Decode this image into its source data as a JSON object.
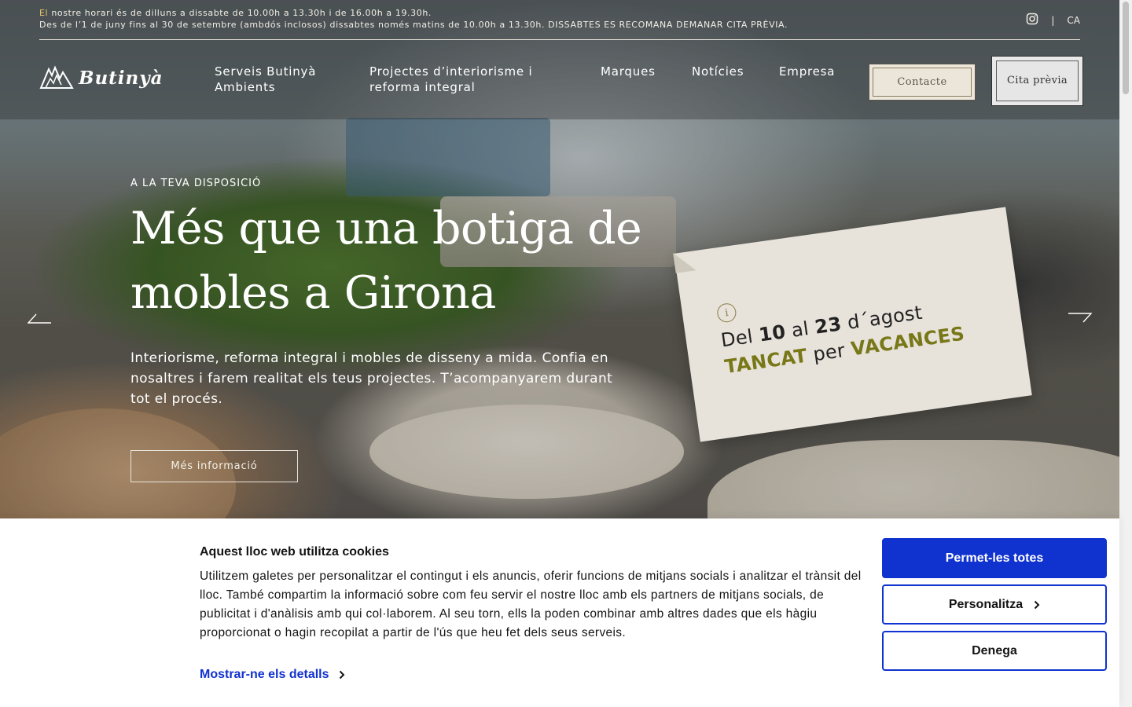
{
  "topbar": {
    "hours_accent": "El",
    "hours_line1": " nostre horari és de dilluns a dissabte de 10.00h a 13.30h i de 16.00h a 19.30h.",
    "hours_line2": "Des de l’1 de juny fins al 30 de setembre (ambdós inclosos) dissabtes només matins de 10.00h a 13.30h. DISSABTES ES RECOMANA DEMANAR CITA PRÈVIA.",
    "instagram_icon": "instagram-icon",
    "separator": "|",
    "language": "CA"
  },
  "logo": {
    "text": "Butinyà"
  },
  "nav": {
    "items": [
      {
        "label": "Serveis Butinyà Ambients"
      },
      {
        "label": "Projectes d’interiorisme i reforma integral"
      },
      {
        "label": "Marques"
      },
      {
        "label": "Notícies"
      },
      {
        "label": "Empresa"
      }
    ],
    "contact_label": "Contacte",
    "appointment_label": "Cita prèvia"
  },
  "hero": {
    "eyebrow": "A LA TEVA DISPOSICIÓ",
    "title": "Més que una botiga de mobles a Girona",
    "description": "Interiorisme, reforma integral i mobles de disseny a mida. Confia en nosaltres i farem realitat els teus projectes. T’acompanyarem durant tot el procés.",
    "cta_label": "Més informació"
  },
  "notice": {
    "info_icon_glyph": "i",
    "line1_prefix": "Del ",
    "line1_day1": "10",
    "line1_mid": " al ",
    "line1_day2": "23",
    "line1_suffix": " d´agost",
    "line2_word1": "TANCAT",
    "line2_mid": " per ",
    "line2_word2": "VACANCES"
  },
  "cookies": {
    "title": "Aquest lloc web utilitza cookies",
    "body": "Utilitzem galetes per personalitzar el contingut i els anuncis, oferir funcions de mitjans socials i analitzar el trànsit del lloc. També compartim la informació sobre com feu servir el nostre lloc amb els partners de mitjans socials, de publicitat i d'anàlisis amb qui col·laborem. Al seu torn, ells la poden combinar amb altres dades que els hàgiu proporcionat o hagin recopilat a partir de l'ús que heu fet dels seus serveis.",
    "details_label": "Mostrar-ne els detalls",
    "allow_all_label": "Permet-les totes",
    "customize_label": "Personalitza",
    "deny_label": "Denega"
  },
  "colors": {
    "accent_blue": "#1032cf",
    "olive": "#787818",
    "note_bg": "#e7e2da"
  }
}
